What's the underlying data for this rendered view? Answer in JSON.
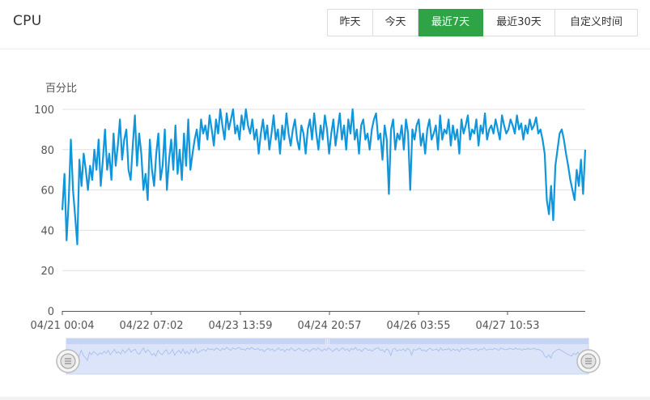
{
  "header": {
    "title": "CPU",
    "buttons": [
      {
        "label": "昨天",
        "active": false
      },
      {
        "label": "今天",
        "active": false
      },
      {
        "label": "最近7天",
        "active": true
      },
      {
        "label": "最近30天",
        "active": false
      },
      {
        "label": "自定义时间",
        "active": false
      }
    ]
  },
  "colors": {
    "line": "#1296db",
    "active_button": "#2ea446",
    "grid": "#e0e0e0",
    "zoom_fill": "#dbe4f8",
    "zoom_line": "#a9bdee"
  },
  "chart_data": {
    "type": "line",
    "ylabel": "百分比",
    "ylim": [
      0,
      100
    ],
    "yticks": [
      "0",
      "20",
      "40",
      "60",
      "80",
      "100"
    ],
    "xtick_labels": [
      "04/21 00:04",
      "04/22 07:02",
      "04/23 13:59",
      "04/24 20:57",
      "04/26 03:55",
      "04/27 10:53"
    ],
    "x_start": "04/21 00:04",
    "x_end": "04/28 20:00",
    "grid": true,
    "zoom_slider": {
      "start": 0,
      "end": 100
    },
    "series": [
      {
        "values": [
          50,
          68,
          35,
          55,
          85,
          60,
          47,
          33,
          75,
          62,
          78,
          70,
          60,
          72,
          65,
          80,
          70,
          85,
          62,
          75,
          90,
          70,
          78,
          65,
          88,
          72,
          82,
          95,
          75,
          85,
          90,
          70,
          65,
          82,
          97,
          72,
          88,
          78,
          60,
          68,
          55,
          85,
          70,
          62,
          78,
          88,
          65,
          72,
          90,
          60,
          75,
          85,
          70,
          92,
          68,
          80,
          65,
          88,
          72,
          95,
          70,
          78,
          85,
          90,
          80,
          95,
          88,
          92,
          85,
          97,
          90,
          82,
          95,
          88,
          100,
          92,
          85,
          98,
          90,
          95,
          100,
          88,
          92,
          85,
          97,
          90,
          100,
          92,
          88,
          95,
          85,
          90,
          78,
          88,
          95,
          85,
          92,
          80,
          88,
          97,
          85,
          90,
          78,
          92,
          85,
          98,
          88,
          82,
          90,
          95,
          85,
          80,
          92,
          88,
          78,
          90,
          95,
          85,
          98,
          88,
          80,
          92,
          85,
          97,
          90,
          78,
          88,
          95,
          82,
          90,
          98,
          85,
          92,
          80,
          95,
          88,
          100,
          85,
          90,
          78,
          92,
          95,
          85,
          88,
          80,
          90,
          95,
          98,
          85,
          88,
          75,
          92,
          85,
          58,
          90,
          95,
          80,
          88,
          85,
          92,
          80,
          95,
          88,
          60,
          90,
          85,
          92,
          95,
          82,
          88,
          78,
          90,
          95,
          85,
          88,
          92,
          80,
          97,
          85,
          90,
          88,
          95,
          82,
          92,
          85,
          90,
          78,
          95,
          88,
          92,
          97,
          85,
          90,
          88,
          95,
          82,
          92,
          88,
          98,
          85,
          90,
          92,
          88,
          95,
          90,
          85,
          97,
          92,
          88,
          90,
          95,
          92,
          88,
          97,
          90,
          93,
          85,
          92,
          88,
          95,
          90,
          92,
          96,
          88,
          90,
          85,
          78,
          55,
          48,
          62,
          45,
          72,
          80,
          88,
          90,
          85,
          78,
          72,
          65,
          60,
          55,
          70,
          62,
          75,
          58,
          80
        ]
      }
    ]
  }
}
